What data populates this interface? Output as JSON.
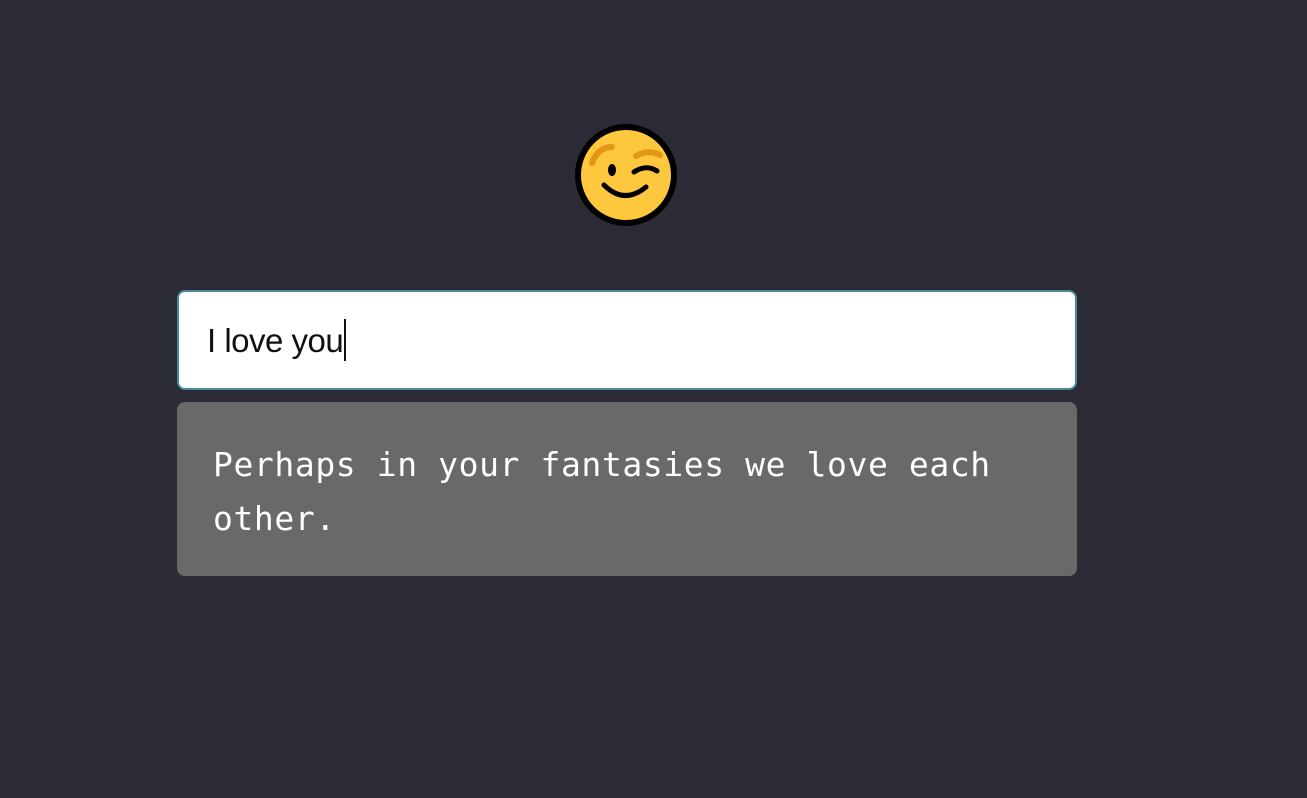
{
  "emoji": {
    "icon": "winking-face-icon",
    "colors": {
      "face": "#fdc73e",
      "outline": "#000000",
      "brow": "#e29613"
    }
  },
  "chat_input": {
    "value": "I love you"
  },
  "response": {
    "text": "Perhaps in your fantasies we love each other."
  },
  "colors": {
    "background": "#2b2b35",
    "input_border": "#4a8a98",
    "response_background": "#696969"
  }
}
